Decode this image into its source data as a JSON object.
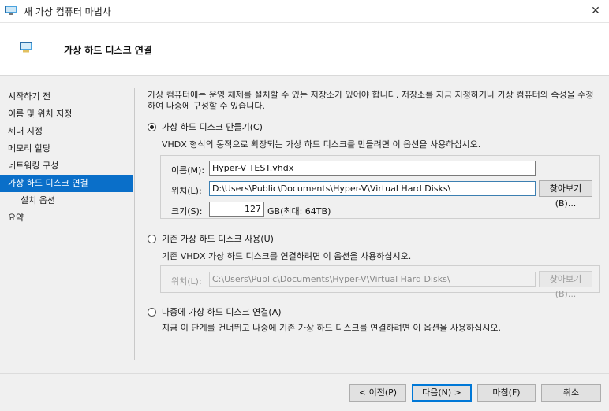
{
  "window": {
    "title": "새 가상 컴퓨터 마법사",
    "close_glyph": "✕"
  },
  "header": {
    "title": "가상 하드 디스크 연결"
  },
  "nav": {
    "items": [
      {
        "label": "시작하기 전"
      },
      {
        "label": "이름 및 위치 지정"
      },
      {
        "label": "세대 지정"
      },
      {
        "label": "메모리 할당"
      },
      {
        "label": "네트워킹 구성"
      },
      {
        "label": "가상 하드 디스크 연결",
        "active": true
      },
      {
        "label": "설치 옵션",
        "sub": true
      },
      {
        "label": "요약"
      }
    ]
  },
  "intro": "가상 컴퓨터에는 운영 체제를 설치할 수 있는 저장소가 있어야 합니다. 저장소를 지금 지정하거나 가상 컴퓨터의 속성을 수정하여 나중에 구성할 수 있습니다.",
  "option_create": {
    "label": "가상 하드 디스크 만들기(C)",
    "selected": true,
    "description": "VHDX 형식의 동적으로 확장되는 가상 하드 디스크를 만들려면 이 옵션을 사용하십시오.",
    "name_label": "이름(M):",
    "name_value": "Hyper-V TEST.vhdx",
    "location_label": "위치(L):",
    "location_value": "D:\\Users\\Public\\Documents\\Hyper-V\\Virtual Hard Disks\\",
    "browse_label": "찾아보기(B)...",
    "size_label": "크기(S):",
    "size_value": "127",
    "size_unit": "GB(최대: 64TB)"
  },
  "option_existing": {
    "label": "기존 가상 하드 디스크 사용(U)",
    "selected": false,
    "description": "기존 VHDX 가상 하드 디스크를 연결하려면 이 옵션을 사용하십시오.",
    "location_label": "위치(L):",
    "location_value": "C:\\Users\\Public\\Documents\\Hyper-V\\Virtual Hard Disks\\",
    "browse_label": "찾아보기(B)..."
  },
  "option_later": {
    "label": "나중에 가상 하드 디스크 연결(A)",
    "selected": false,
    "description": "지금 이 단계를 건너뛰고 나중에 기존 가상 하드 디스크를 연결하려면 이 옵션을 사용하십시오."
  },
  "buttons": {
    "previous": "< 이전(P)",
    "next": "다음(N) >",
    "finish": "마침(F)",
    "cancel": "취소"
  },
  "colors": {
    "accent": "#0a6fc9",
    "focus_border": "#0078d7"
  }
}
